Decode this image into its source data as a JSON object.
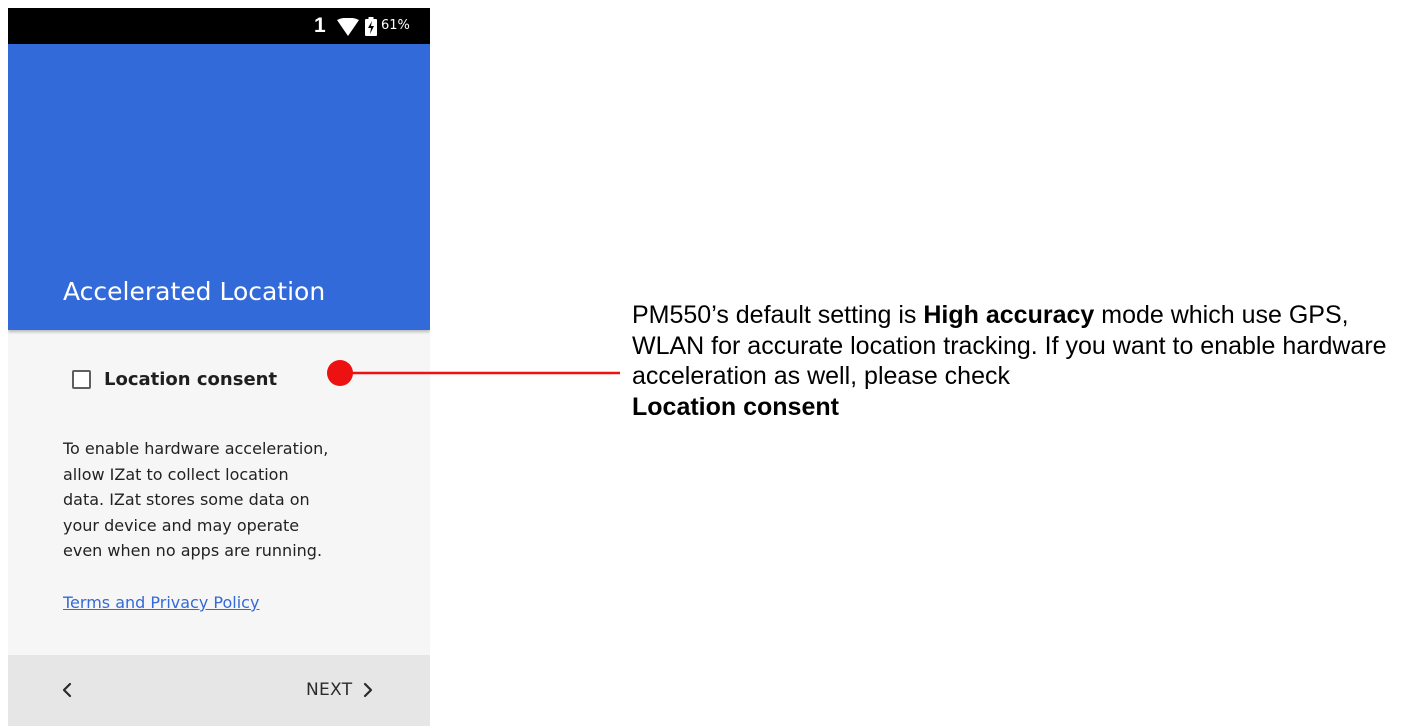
{
  "status_bar": {
    "sim_indicator": "1",
    "battery_percent": "61%",
    "icons": [
      "wifi-icon",
      "battery-charging-icon"
    ]
  },
  "header": {
    "title": "Accelerated Location",
    "color": "#336ad9"
  },
  "consent": {
    "label": "Location consent",
    "checked": false
  },
  "body": {
    "lines": [
      "To enable hardware acceleration,",
      "allow IZat to collect location",
      "data. IZat stores some data on",
      "your device and may operate",
      "even when no apps are running."
    ],
    "link": "Terms and Privacy Policy",
    "link_color": "#336ad9"
  },
  "nav": {
    "back_icon": "chevron-left-icon",
    "next_label": "NEXT",
    "next_icon": "chevron-right-icon"
  },
  "callout": {
    "marker_color": "#ee1111",
    "segments": [
      {
        "text": "PM550’s default setting is ",
        "bold": false
      },
      {
        "text": "High accuracy",
        "bold": true
      },
      {
        "text": " mode which use GPS, WLAN for accurate location tracking. If you want to enable hardware acceleration as well, please check ",
        "bold": false
      },
      {
        "text": "Location consent",
        "bold": true
      }
    ]
  }
}
